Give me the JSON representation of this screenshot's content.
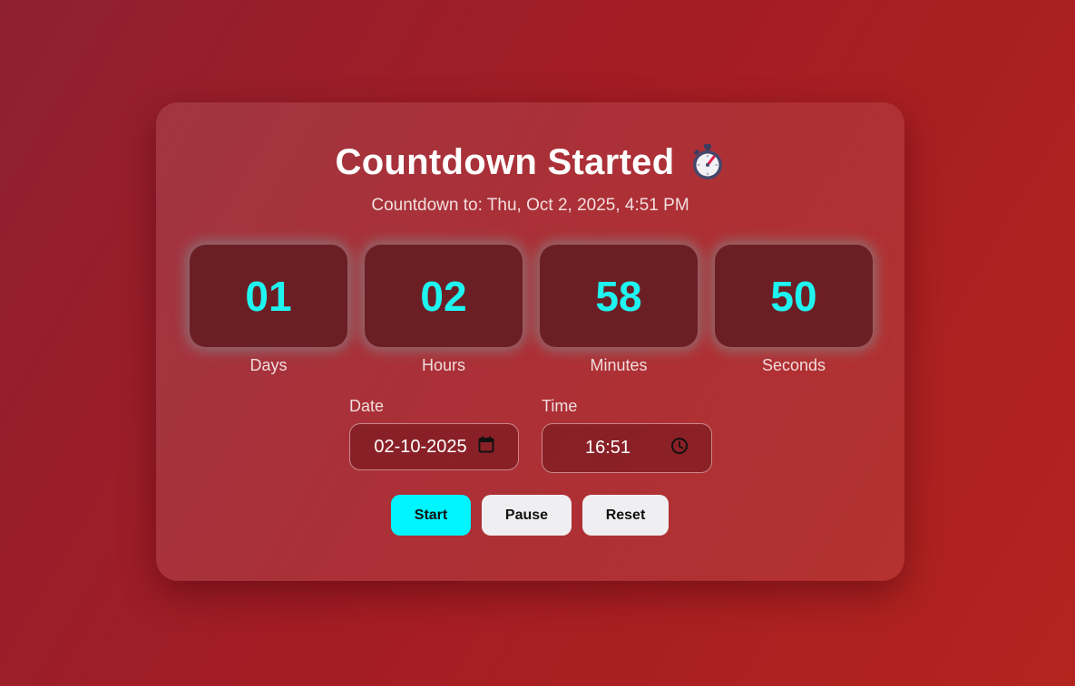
{
  "title": {
    "text": "Countdown Started",
    "icon": "stopwatch-icon"
  },
  "subtitle": "Countdown to: Thu, Oct 2, 2025, 4:51 PM",
  "countdown": [
    {
      "value": "01",
      "label": "Days"
    },
    {
      "value": "02",
      "label": "Hours"
    },
    {
      "value": "58",
      "label": "Minutes"
    },
    {
      "value": "50",
      "label": "Seconds"
    }
  ],
  "date_field": {
    "label": "Date",
    "value": "02-10-2025",
    "icon": "calendar-icon"
  },
  "time_field": {
    "label": "Time",
    "value": "16:51",
    "icon": "clock-icon"
  },
  "buttons": {
    "start": "Start",
    "pause": "Pause",
    "reset": "Reset"
  },
  "colors": {
    "accent": "#00f5ff",
    "digits": "#1ff5f0",
    "box": "#6b1f25"
  }
}
